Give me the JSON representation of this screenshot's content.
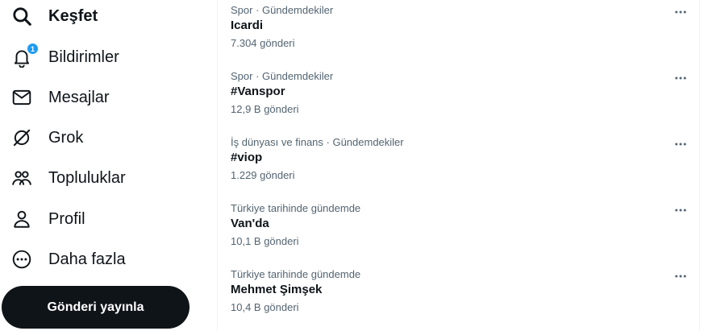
{
  "sidebar": {
    "items": [
      {
        "label": "Keşfet",
        "icon": "search-icon",
        "active": true
      },
      {
        "label": "Bildirimler",
        "icon": "bell-icon",
        "badge": "1"
      },
      {
        "label": "Mesajlar",
        "icon": "envelope-icon"
      },
      {
        "label": "Grok",
        "icon": "grok-icon"
      },
      {
        "label": "Topluluklar",
        "icon": "communities-icon"
      },
      {
        "label": "Profil",
        "icon": "person-icon"
      },
      {
        "label": "Daha fazla",
        "icon": "more-circle-icon"
      }
    ],
    "post_button": "Gönderi yayınla"
  },
  "trends": [
    {
      "meta": "Spor · Gündemdekiler",
      "name": "Icardi",
      "count": "7.304 gönderi"
    },
    {
      "meta": "Spor · Gündemdekiler",
      "name": "#Vanspor",
      "count": "12,9 B gönderi"
    },
    {
      "meta": "İş dünyası ve finans · Gündemdekiler",
      "name": "#viop",
      "count": "1.229 gönderi"
    },
    {
      "meta": "Türkiye tarihinde gündemde",
      "name": "Van'da",
      "count": "10,1 B gönderi"
    },
    {
      "meta": "Türkiye tarihinde gündemde",
      "name": "Mehmet Şimşek",
      "count": "10,4 B gönderi"
    }
  ],
  "colors": {
    "accent": "#1d9bf0",
    "text": "#0f1419",
    "secondary": "#536471",
    "button": "#0f1419"
  }
}
